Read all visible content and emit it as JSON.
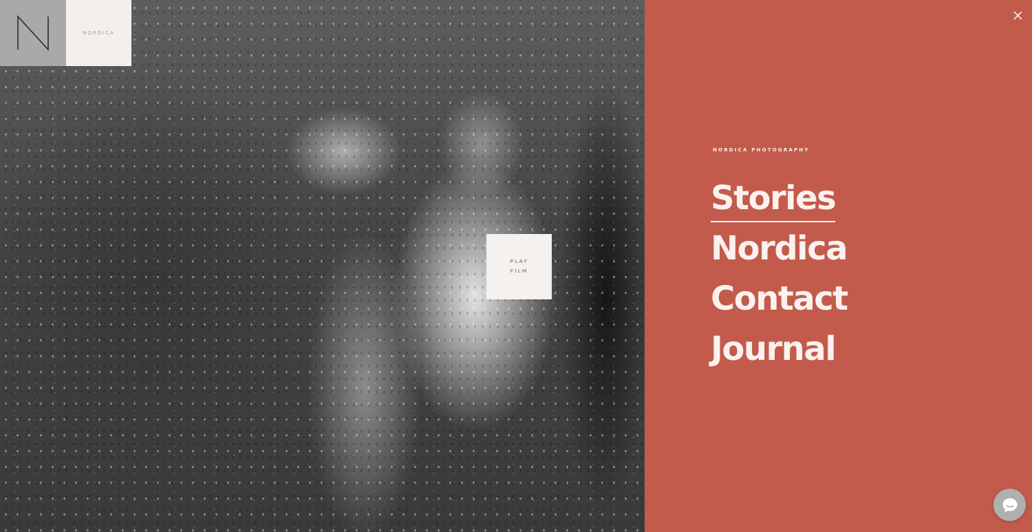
{
  "logo": {
    "mark_icon": "n-monogram-icon",
    "name": "NORDICA"
  },
  "hero": {
    "play_film_line1": "PLAY",
    "play_film_line2": "FILM"
  },
  "menu": {
    "eyebrow": "NORDICA PHOTOGRAPHY",
    "items": [
      {
        "label": "Stories",
        "active": true
      },
      {
        "label": "Nordica",
        "active": false
      },
      {
        "label": "Contact",
        "active": false
      },
      {
        "label": "Journal",
        "active": false
      }
    ],
    "close_icon": "close-icon"
  },
  "chat": {
    "icon": "chat-bubble-icon"
  },
  "colors": {
    "panel_bg": "#c35b4c",
    "panel_text": "#fbf1ee",
    "logo_mark_bg": "#a9a9a9",
    "logo_name_bg": "#f4efec",
    "chat_bg": "#b0b0b0"
  }
}
